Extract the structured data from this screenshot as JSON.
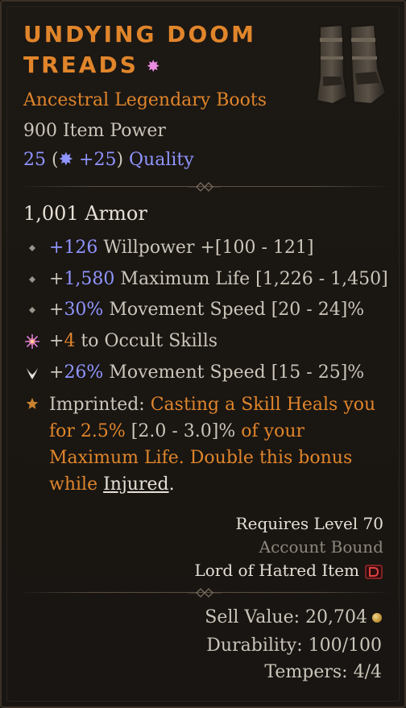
{
  "item": {
    "name": "Undying Doom Treads",
    "subtitle": "Ancestral Legendary Boots",
    "item_power": "900 Item Power",
    "quality": {
      "base": "25",
      "open": " (",
      "bonus": " +25",
      "close": ") ",
      "label": "Quality"
    },
    "armor": "1,001 Armor"
  },
  "affixes": [
    {
      "icon": "diamond-bullet-icon",
      "value": "+126",
      "text": " Willpower +[100 - 121]"
    },
    {
      "icon": "diamond-bullet-icon",
      "value_prefix": "+",
      "value": "1,580",
      "text": " Maximum Life [1,226 - 1,450]"
    },
    {
      "icon": "diamond-bullet-icon",
      "value_prefix": "+",
      "value": "30%",
      "text": " Movement Speed [20 - 24]%"
    },
    {
      "icon": "occult-sigil-icon",
      "value_prefix": "+",
      "value": "4",
      "text": " to Occult Skills"
    },
    {
      "icon": "tempered-claw-icon",
      "value_prefix": "+",
      "value": "26%",
      "text": " Movement Speed [15 - 25]%"
    }
  ],
  "imprint": {
    "icon": "star-icon",
    "label": "Imprinted: ",
    "text1": "Casting a Skill Heals you for ",
    "value": "2.5%",
    "range": " [2.0 - 3.0]%",
    "text2": " of your Maximum Life. Double this bonus while ",
    "keyword": "Injured",
    "end": "."
  },
  "footer": {
    "requires": "Requires Level 70",
    "bound": "Account Bound",
    "lord": "Lord of Hatred Item",
    "sell_value": "Sell Value: 20,704",
    "durability": "Durability: 100/100",
    "tempers": "Tempers: 4/4"
  },
  "colors": {
    "legendary": "#e0852b",
    "blue_stat": "#8f95ff",
    "text": "#cbc5ba",
    "muted": "#8d877d"
  }
}
